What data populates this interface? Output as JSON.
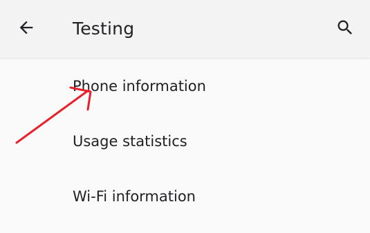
{
  "appbar": {
    "title": "Testing",
    "back_icon": "arrow-back-icon",
    "search_icon": "search-icon"
  },
  "list": {
    "items": [
      {
        "label": "Phone information"
      },
      {
        "label": "Usage statistics"
      },
      {
        "label": "Wi-Fi information"
      }
    ]
  },
  "annotation": {
    "type": "hand-drawn-arrow",
    "color": "#e8202a",
    "points_to": "Phone information"
  },
  "colors": {
    "appbar_bg": "#f3f3f3",
    "page_bg": "#fafafa",
    "text": "#202124"
  }
}
